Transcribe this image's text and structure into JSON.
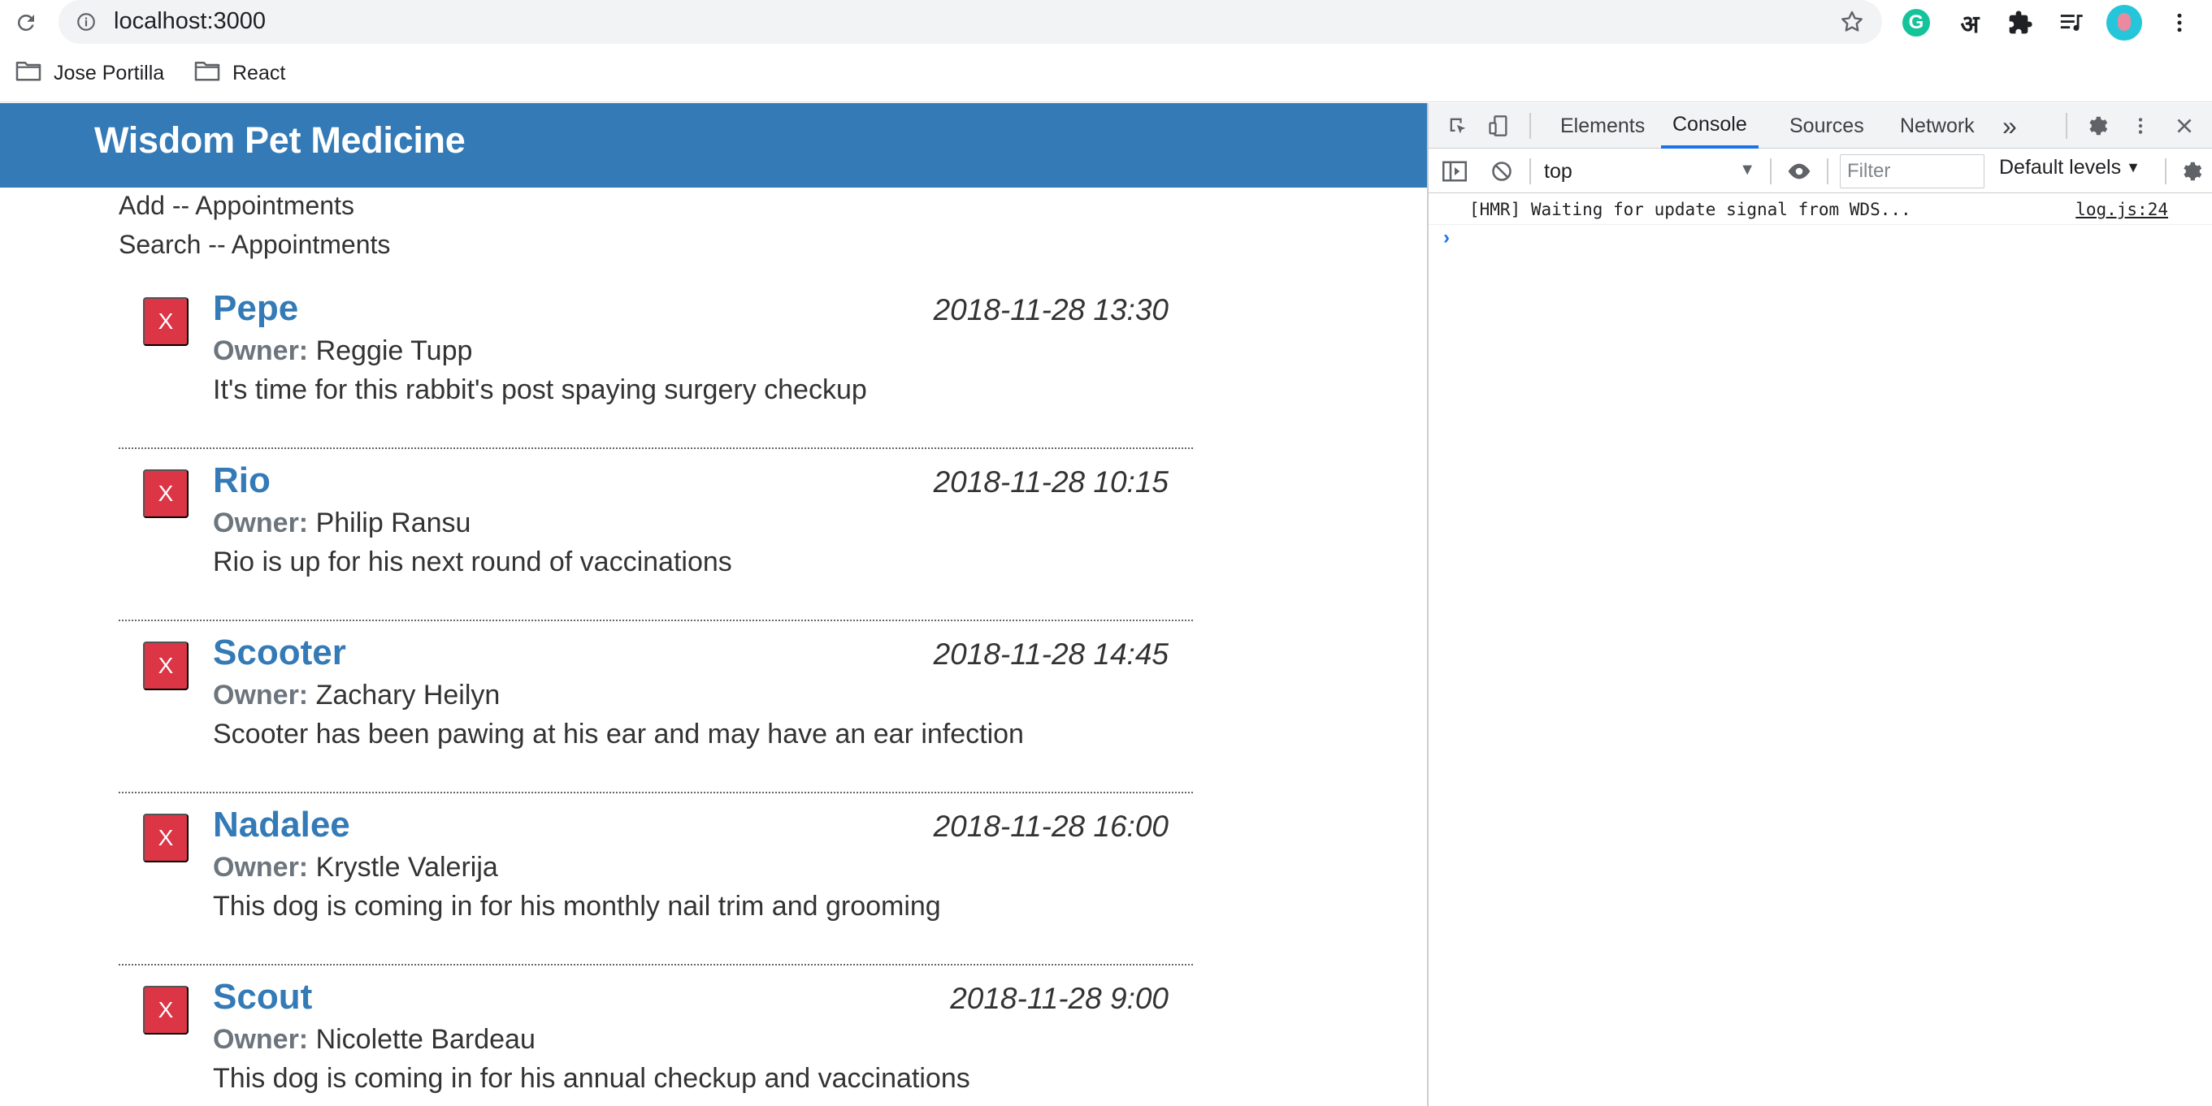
{
  "browser": {
    "url": "localhost:3000",
    "extensions": {
      "grammarly_glyph": "G",
      "hindi_glyph": "अ"
    },
    "bookmarks": [
      {
        "label": "Jose Portilla"
      },
      {
        "label": "React"
      }
    ]
  },
  "app": {
    "title": "Wisdom Pet Medicine",
    "add_text": "Add -- Appointments",
    "search_text": "Search -- Appointments",
    "owner_label": "Owner:",
    "delete_label": "X",
    "accent_color": "#337ab7",
    "delete_color": "#dc3545",
    "appointments": [
      {
        "pet": "Pepe",
        "date": "2018-11-28 13:30",
        "owner": "Reggie Tupp",
        "notes": "It's time for this rabbit's post spaying surgery checkup"
      },
      {
        "pet": "Rio",
        "date": "2018-11-28 10:15",
        "owner": "Philip Ransu",
        "notes": "Rio is up for his next round of vaccinations"
      },
      {
        "pet": "Scooter",
        "date": "2018-11-28 14:45",
        "owner": "Zachary Heilyn",
        "notes": "Scooter has been pawing at his ear and may have an ear infection"
      },
      {
        "pet": "Nadalee",
        "date": "2018-11-28 16:00",
        "owner": "Krystle Valerija",
        "notes": "This dog is coming in for his monthly nail trim and grooming"
      },
      {
        "pet": "Scout",
        "date": "2018-11-28 9:00",
        "owner": "Nicolette Bardeau",
        "notes": "This dog is coming in for his annual checkup and vaccinations"
      }
    ]
  },
  "devtools": {
    "tabs": [
      "Elements",
      "Console",
      "Sources",
      "Network"
    ],
    "active_tab": "Console",
    "more_tabs": "»",
    "context": "top",
    "filter_placeholder": "Filter",
    "levels": "Default levels",
    "console": {
      "message": "[HMR] Waiting for update signal from WDS...",
      "source": "log.js:24",
      "prompt": "›"
    }
  }
}
